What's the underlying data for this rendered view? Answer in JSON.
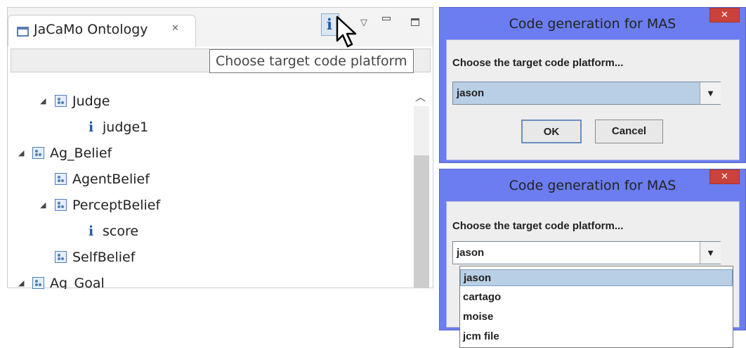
{
  "view": {
    "tab_title": "JaCaMo Ontology",
    "tab_close_glyph": "✕",
    "info_button_glyph": "i",
    "tooltip": "Choose target code platform"
  },
  "tree": [
    {
      "label": "Judge",
      "kind": "class",
      "expanded": true
    },
    {
      "label": "judge1",
      "kind": "individual"
    },
    {
      "label": "Ag_Belief",
      "kind": "class",
      "expanded": true
    },
    {
      "label": "AgentBelief",
      "kind": "class"
    },
    {
      "label": "PerceptBelief",
      "kind": "class",
      "expanded": true
    },
    {
      "label": "score",
      "kind": "individual"
    },
    {
      "label": "SelfBelief",
      "kind": "class"
    },
    {
      "label": "Ag_Goal",
      "kind": "class",
      "expanded": true
    }
  ],
  "dialog1": {
    "title": "Code generation for MAS",
    "prompt": "Choose the target code platform...",
    "selected": "jason",
    "ok_label": "OK",
    "cancel_label": "Cancel"
  },
  "dialog2": {
    "title": "Code generation for MAS",
    "prompt": "Choose the target code platform...",
    "selected": "jason",
    "options": [
      "jason",
      "cartago",
      "moise",
      "jcm file"
    ]
  },
  "colors": {
    "dialog_frame": "#6b7df0",
    "close_button": "#c9433a",
    "selection": "#b8cfe5",
    "icon_blue": "#2358a8"
  }
}
